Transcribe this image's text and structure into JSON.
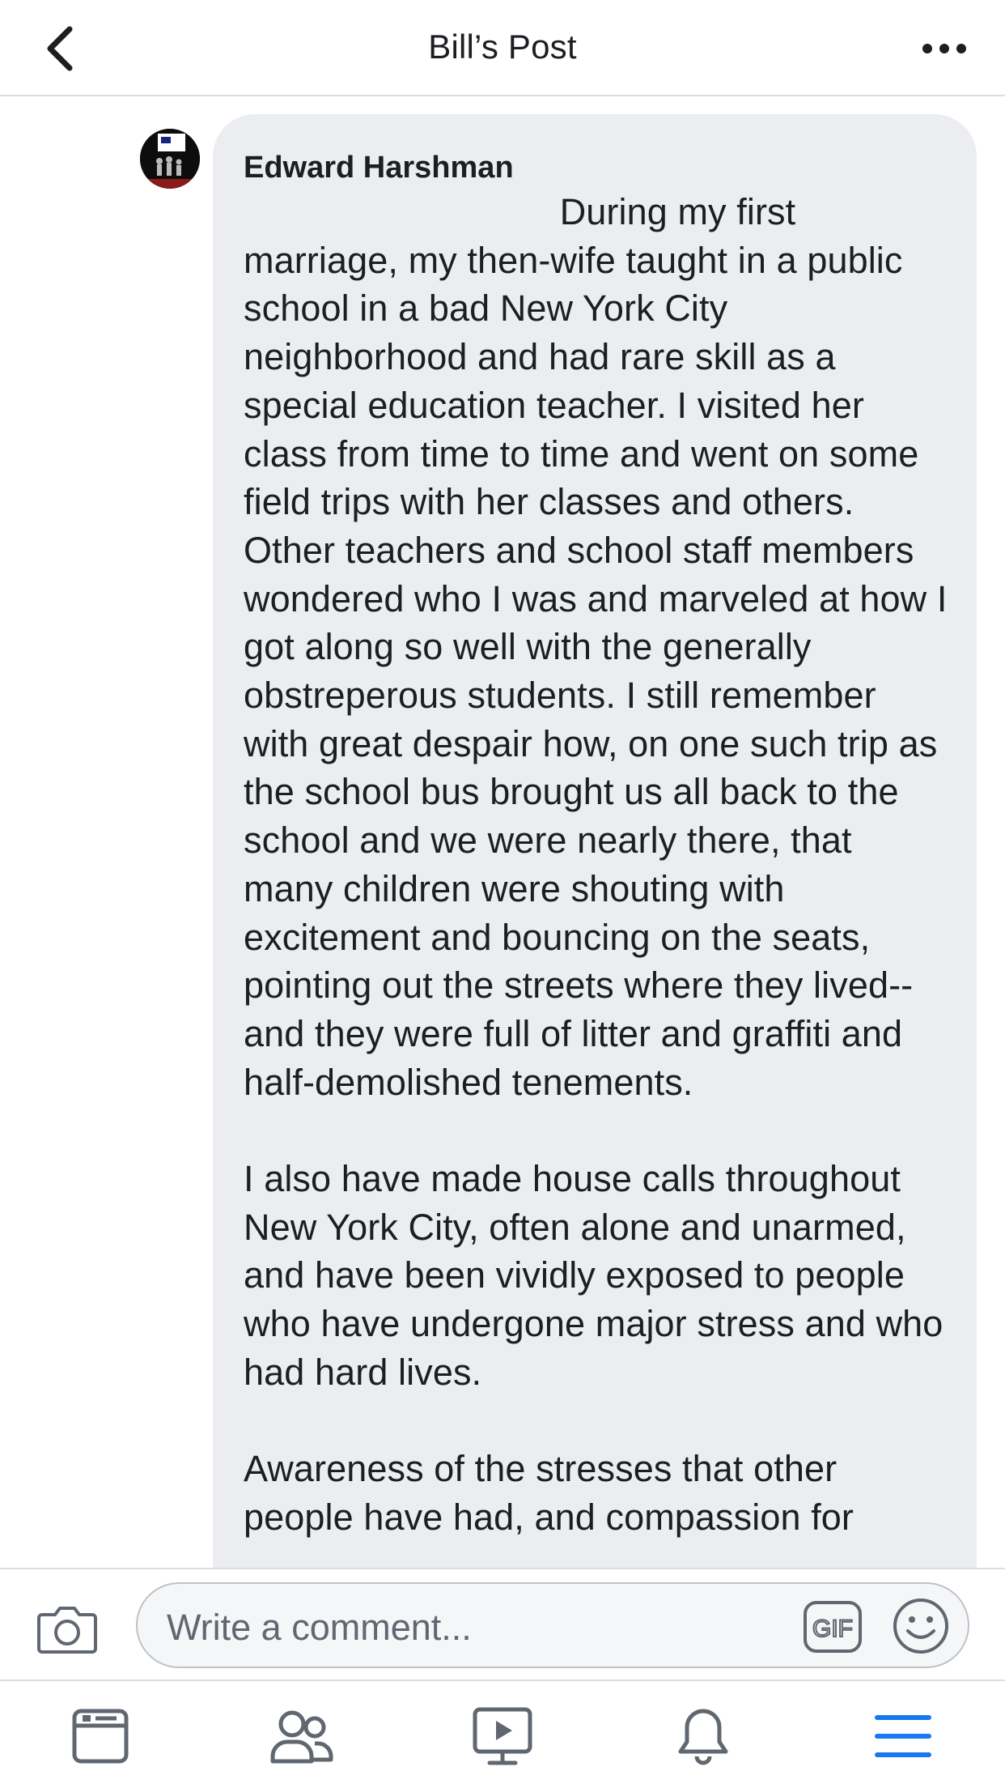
{
  "header": {
    "title": "Bill’s Post",
    "back_icon": "chevron-left-icon",
    "more_icon": "more-horizontal-icon"
  },
  "comment": {
    "author": "Edward Harshman",
    "text": "                               During my first marriage, my then-wife taught in a public school in a bad New York City neighborhood and had rare skill as a special education teacher. I visited her class from time to time and went on some field trips with her classes and others. Other teachers and school staff members wondered who I was and marveled at how I got along so well with the generally obstreperous students. I still remember with great despair how, on one such trip as the school bus brought us all back to the school and we were nearly there, that many children were shouting with excitement and bouncing on the seats, pointing out the streets where they lived--and they were full of litter and graffiti and half-demolished tenements.\n\nI also have made house calls throughout New York City, often alone and unarmed, and have been vividly exposed to people who have undergone major stress and who had hard lives.\n\nAwareness of the stresses that other people have had, and compassion for"
  },
  "composer": {
    "placeholder": "Write a comment...",
    "gif_label": "GIF"
  },
  "nav": {
    "items": [
      "news-feed-icon",
      "friends-icon",
      "watch-icon",
      "notifications-icon",
      "menu-icon"
    ],
    "active": "menu-icon"
  },
  "colors": {
    "accent": "#1877f2",
    "bubble": "#ebedf0",
    "icon_gray": "#606770",
    "divider": "#dadde1"
  }
}
